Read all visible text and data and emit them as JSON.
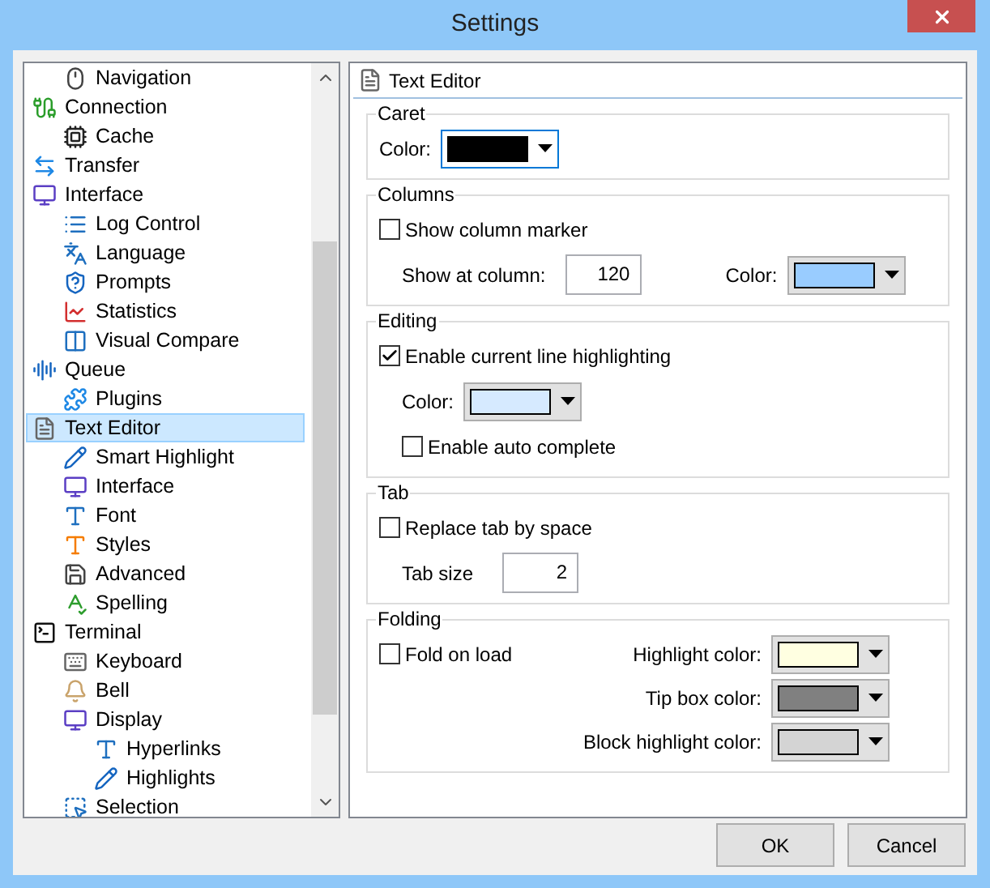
{
  "window": {
    "title": "Settings"
  },
  "tree": {
    "items": [
      {
        "children": [
          {
            "label": "Navigation",
            "selected": false
          }
        ]
      },
      {
        "label": "Connection",
        "selected": false,
        "children": [
          {
            "label": "Cache",
            "selected": false
          }
        ]
      },
      {
        "label": "Transfer",
        "selected": false
      },
      {
        "label": "Interface",
        "selected": false,
        "children": [
          {
            "label": "Log Control",
            "selected": false
          },
          {
            "label": "Language",
            "selected": false
          },
          {
            "label": "Prompts",
            "selected": false
          },
          {
            "label": "Statistics",
            "selected": false
          },
          {
            "label": "Visual Compare",
            "selected": false
          }
        ]
      },
      {
        "label": "Queue",
        "selected": false,
        "children": [
          {
            "label": "Plugins",
            "selected": false
          }
        ]
      },
      {
        "label": "Text Editor",
        "selected": true,
        "children": [
          {
            "label": "Smart Highlight",
            "selected": false
          },
          {
            "label": "Interface",
            "selected": false
          },
          {
            "label": "Font",
            "selected": false
          },
          {
            "label": "Styles",
            "selected": false
          },
          {
            "label": "Advanced",
            "selected": false
          },
          {
            "label": "Spelling",
            "selected": false
          }
        ]
      },
      {
        "label": "Terminal",
        "selected": false,
        "children": [
          {
            "label": "Keyboard",
            "selected": false
          },
          {
            "label": "Bell",
            "selected": false
          },
          {
            "label": "Display",
            "selected": false,
            "children": [
              {
                "label": "Hyperlinks",
                "selected": false
              },
              {
                "label": "Highlights",
                "selected": false
              }
            ]
          },
          {
            "label": "Selection",
            "selected": false
          }
        ]
      }
    ]
  },
  "panel": {
    "title": "Text Editor",
    "groups": [
      {
        "title": "Caret",
        "kind": "stack",
        "rows": [
          [
            {
              "kind": "color",
              "label": "Color:",
              "color": "#000000",
              "focused": true
            }
          ]
        ]
      },
      {
        "title": "Columns",
        "kind": "stack",
        "rows": [
          [
            {
              "kind": "checkbox",
              "label": "Show column marker",
              "checked": false
            }
          ],
          [
            {
              "kind": "number",
              "label": "Show at column:",
              "value": "120"
            },
            {
              "kind": "color",
              "label": "Color:",
              "color": "#99ccff",
              "focused": false
            }
          ]
        ]
      },
      {
        "title": "Editing",
        "kind": "stack",
        "rows": [
          [
            {
              "kind": "checkbox",
              "label": "Enable current line highlighting",
              "checked": true
            }
          ],
          [
            {
              "kind": "color",
              "label": "Color:",
              "color": "#d6eaff",
              "focused": false
            }
          ],
          [
            {
              "kind": "checkbox",
              "label": "Enable auto complete",
              "checked": false
            }
          ]
        ]
      },
      {
        "title": "Tab",
        "kind": "stack",
        "rows": [
          [
            {
              "kind": "checkbox",
              "label": "Replace tab by space",
              "checked": false
            }
          ],
          [
            {
              "kind": "number",
              "label": "Tab size",
              "value": "2"
            }
          ]
        ]
      },
      {
        "title": "Folding",
        "kind": "split",
        "left": [
          {
            "kind": "checkbox",
            "label": "Fold on load",
            "checked": false
          }
        ],
        "right": [
          {
            "kind": "color",
            "label": "Highlight color:",
            "color": "#ffffe1",
            "focused": false
          },
          {
            "kind": "color",
            "label": "Tip box color:",
            "color": "#808080",
            "focused": false
          },
          {
            "kind": "color",
            "label": "Block highlight color:",
            "color": "#d4d4d4",
            "focused": false
          }
        ]
      }
    ]
  },
  "buttons": [
    {
      "label": "OK"
    },
    {
      "label": "Cancel"
    }
  ]
}
